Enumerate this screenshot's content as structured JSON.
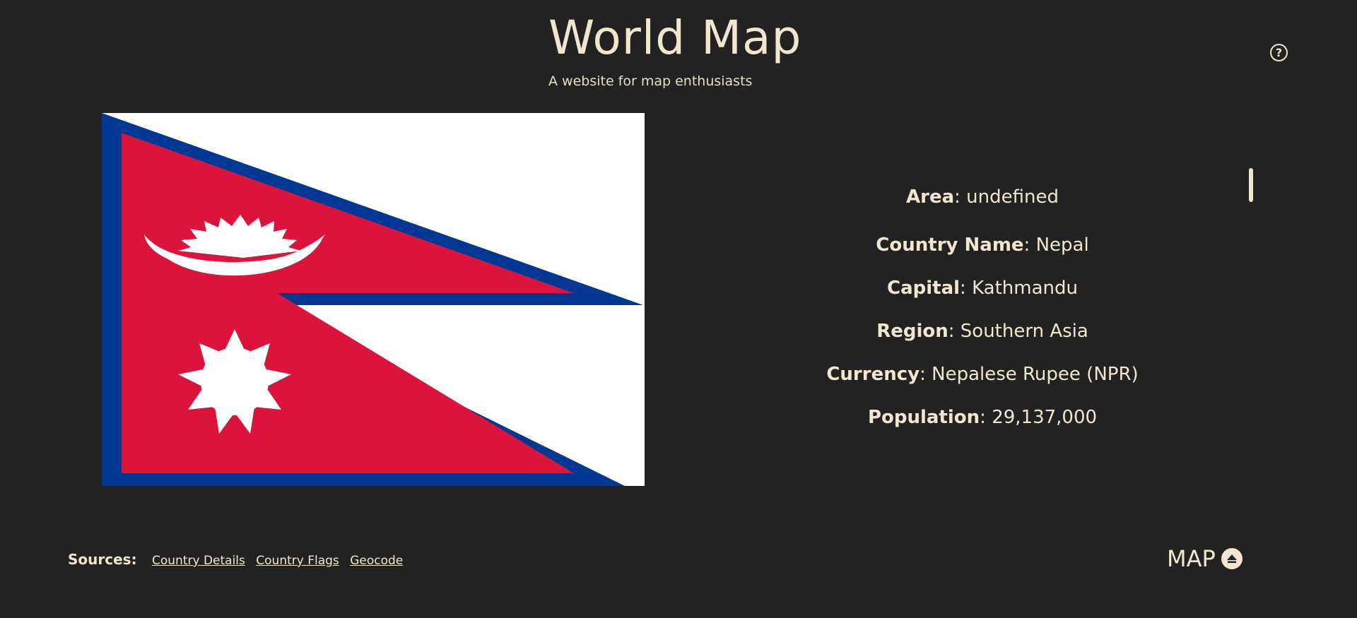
{
  "header": {
    "title": "World Map",
    "subtitle": "A website for map enthusiasts",
    "help_label": "?"
  },
  "country": {
    "flag_icon": "flag-of-nepal",
    "rows": [
      {
        "key": "Area",
        "value": "undefined"
      },
      {
        "key": "Country Name",
        "value": "Nepal"
      },
      {
        "key": "Capital",
        "value": "Kathmandu"
      },
      {
        "key": "Region",
        "value": "Southern Asia"
      },
      {
        "key": "Currency",
        "value": "Nepalese Rupee (NPR)"
      },
      {
        "key": "Population",
        "value": "29,137,000"
      }
    ]
  },
  "footer": {
    "sources_label": "Sources:",
    "links": [
      "Country Details",
      "Country Flags",
      "Geocode"
    ],
    "map_label": "MAP"
  },
  "colors": {
    "background": "#222222",
    "text": "#f3e6d0",
    "flag_red": "#dc143c",
    "flag_blue": "#003893"
  }
}
